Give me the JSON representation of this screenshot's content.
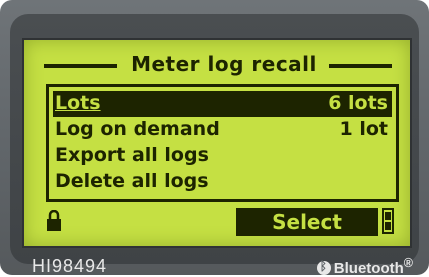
{
  "screen": {
    "title": "Meter log recall"
  },
  "menu": {
    "items": [
      {
        "label": "Lots",
        "value": "6 lots",
        "selected": true
      },
      {
        "label": "Log on demand",
        "value": "1 lot",
        "selected": false
      },
      {
        "label": "Export all logs",
        "value": "",
        "selected": false
      },
      {
        "label": "Delete all logs",
        "value": "",
        "selected": false
      }
    ]
  },
  "softkeys": {
    "select_label": "Select"
  },
  "device": {
    "model": "HI98494",
    "bluetooth_label": "Bluetooth",
    "bluetooth_mark": "®"
  },
  "colors": {
    "lcd_background": "#c5e043",
    "lcd_ink": "#1d2400",
    "device_body": "#5f6468"
  },
  "icons": [
    "lock-icon",
    "battery-icon",
    "bluetooth-icon"
  ]
}
